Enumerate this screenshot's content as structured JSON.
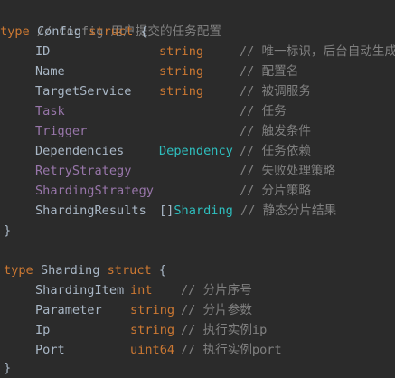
{
  "code": {
    "comment1": "// Config 用户提交的任务配置",
    "kw_type": "type",
    "kw_struct": "struct",
    "brace_open": "{",
    "brace_close": "}",
    "config_name": "Config",
    "fields_config": [
      {
        "name": "ID",
        "type": "string",
        "comment": "// 唯一标识，后台自动生成"
      },
      {
        "name": "Name",
        "type": "string",
        "comment": "// 配置名"
      },
      {
        "name": "TargetService",
        "type": "string",
        "comment": "// 被调服务"
      },
      {
        "name": "Task",
        "type": "",
        "comment": "// 任务"
      },
      {
        "name": "Trigger",
        "type": "",
        "comment": "// 触发条件"
      },
      {
        "name": "Dependencies",
        "type": "Dependency",
        "comment": "// 任务依赖"
      },
      {
        "name": "RetryStrategy",
        "type": "",
        "comment": "// 失败处理策略"
      },
      {
        "name": "ShardingStrategy",
        "type": "",
        "comment": "// 分片策略"
      },
      {
        "name": "ShardingResults",
        "type_prefix": "[]",
        "type": "Sharding",
        "comment": "// 静态分片结果"
      }
    ],
    "sharding_name": "Sharding",
    "fields_sharding": [
      {
        "name": "ShardingItem",
        "type": "int",
        "comment": "// 分片序号"
      },
      {
        "name": "Parameter",
        "type": "string",
        "comment": "// 分片参数"
      },
      {
        "name": "Ip",
        "type": "string",
        "comment": "// 执行实例ip"
      },
      {
        "name": "Port",
        "type": "uint64",
        "comment": "// 执行实例port"
      }
    ]
  },
  "colors": {
    "background": "#2b2b2b",
    "keyword": "#cc7832",
    "comment": "#808080",
    "field": "#a9b7c6",
    "embedded_field": "#9876aa",
    "type_ref": "#2ebfbf"
  }
}
